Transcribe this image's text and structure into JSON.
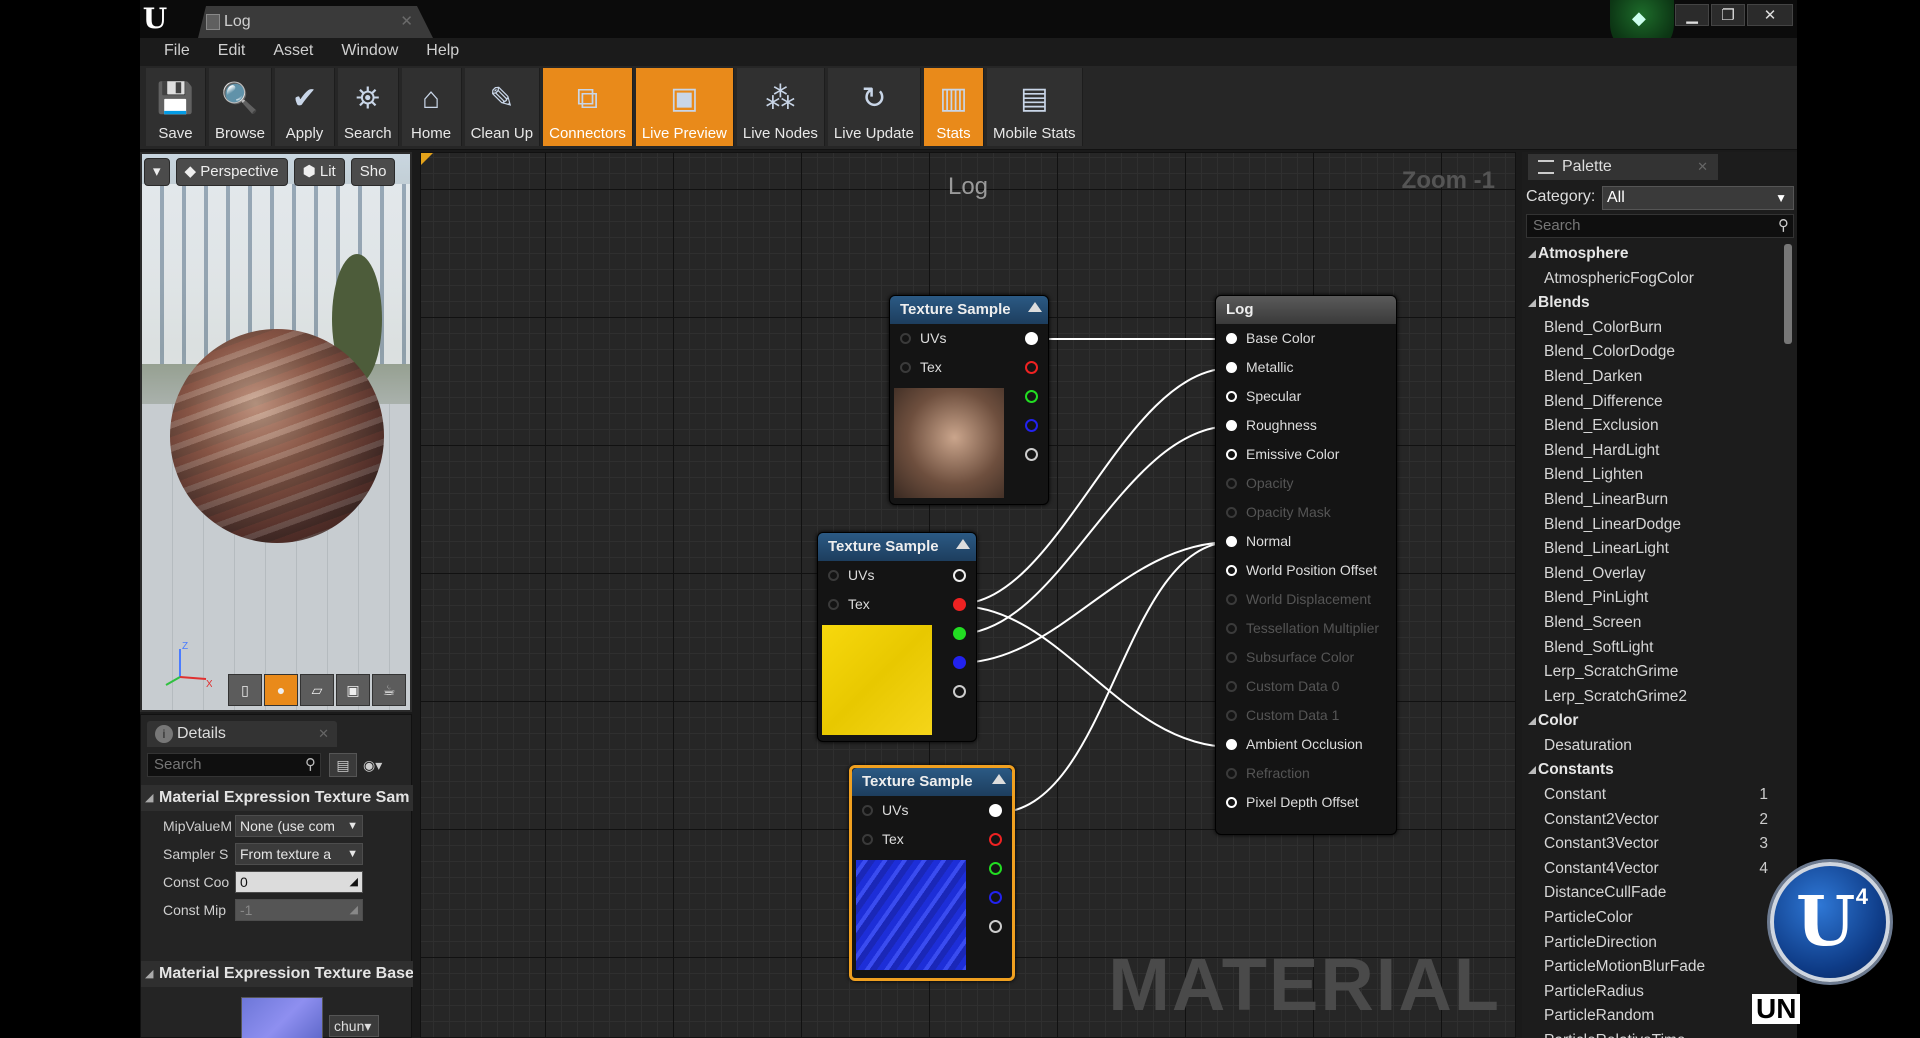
{
  "window": {
    "title": "Log",
    "notify_icon": "notification-icon"
  },
  "menu": [
    "File",
    "Edit",
    "Asset",
    "Window",
    "Help"
  ],
  "toolbar": [
    {
      "label": "Save",
      "icon": "save-icon",
      "active": false
    },
    {
      "label": "Browse",
      "icon": "browse-icon",
      "active": false
    },
    {
      "label": "Apply",
      "icon": "apply-check-icon",
      "active": false
    },
    {
      "label": "Search",
      "icon": "search-binoculars-icon",
      "active": false
    },
    {
      "label": "Home",
      "icon": "home-icon",
      "active": false
    },
    {
      "label": "Clean Up",
      "icon": "clean-up-icon",
      "active": false
    },
    {
      "label": "Connectors",
      "icon": "connectors-icon",
      "active": true
    },
    {
      "label": "Live Preview",
      "icon": "live-preview-icon",
      "active": true
    },
    {
      "label": "Live Nodes",
      "icon": "live-nodes-icon",
      "active": false
    },
    {
      "label": "Live Update",
      "icon": "live-update-icon",
      "active": false
    },
    {
      "label": "Stats",
      "icon": "stats-icon",
      "active": true
    },
    {
      "label": "Mobile Stats",
      "icon": "mobile-stats-icon",
      "active": false
    }
  ],
  "viewport": {
    "perspective": "Perspective",
    "lit": "Lit",
    "show": "Sho"
  },
  "details": {
    "tab": "Details",
    "search_placeholder": "Search",
    "section1": "Material Expression Texture Sam",
    "props": [
      {
        "label": "MipValueM",
        "value": "None (use com",
        "kind": "dropdown"
      },
      {
        "label": "Sampler S",
        "value": "From texture a",
        "kind": "dropdown"
      },
      {
        "label": "Const Coo",
        "value": "0",
        "kind": "text"
      },
      {
        "label": "Const Mip",
        "value": "-1",
        "kind": "disabled"
      }
    ],
    "section2": "Material Expression Texture Base",
    "texture_chip": "chun"
  },
  "graph": {
    "title": "Log",
    "zoom": "Zoom -1",
    "watermark": "MATERIAL",
    "nodes": [
      {
        "title": "Texture Sample",
        "pins": [
          "UVs",
          "Tex"
        ],
        "thumb": "#8b6a52"
      },
      {
        "title": "Texture Sample",
        "pins": [
          "UVs",
          "Tex"
        ],
        "thumb": "#f5d20a"
      },
      {
        "title": "Texture Sample",
        "pins": [
          "UVs",
          "Tex"
        ],
        "thumb": "#1e2fd8"
      }
    ],
    "result": {
      "title": "Log",
      "inputs": [
        {
          "label": "Base Color",
          "enabled": true,
          "connected": true
        },
        {
          "label": "Metallic",
          "enabled": true,
          "connected": true
        },
        {
          "label": "Specular",
          "enabled": true,
          "connected": false
        },
        {
          "label": "Roughness",
          "enabled": true,
          "connected": true
        },
        {
          "label": "Emissive Color",
          "enabled": true,
          "connected": false
        },
        {
          "label": "Opacity",
          "enabled": false,
          "connected": false
        },
        {
          "label": "Opacity Mask",
          "enabled": false,
          "connected": false
        },
        {
          "label": "Normal",
          "enabled": true,
          "connected": true
        },
        {
          "label": "World Position Offset",
          "enabled": true,
          "connected": false
        },
        {
          "label": "World Displacement",
          "enabled": false,
          "connected": false
        },
        {
          "label": "Tessellation Multiplier",
          "enabled": false,
          "connected": false
        },
        {
          "label": "Subsurface Color",
          "enabled": false,
          "connected": false
        },
        {
          "label": "Custom Data 0",
          "enabled": false,
          "connected": false
        },
        {
          "label": "Custom Data 1",
          "enabled": false,
          "connected": false
        },
        {
          "label": "Ambient Occlusion",
          "enabled": true,
          "connected": true
        },
        {
          "label": "Refraction",
          "enabled": false,
          "connected": false
        },
        {
          "label": "Pixel Depth Offset",
          "enabled": true,
          "connected": false
        }
      ]
    }
  },
  "palette": {
    "tab": "Palette",
    "category_label": "Category:",
    "category_value": "All",
    "search_placeholder": "Search",
    "list": [
      {
        "type": "cat",
        "label": "Atmosphere"
      },
      {
        "type": "item",
        "label": "AtmosphericFogColor"
      },
      {
        "type": "cat",
        "label": "Blends"
      },
      {
        "type": "item",
        "label": "Blend_ColorBurn"
      },
      {
        "type": "item",
        "label": "Blend_ColorDodge"
      },
      {
        "type": "item",
        "label": "Blend_Darken"
      },
      {
        "type": "item",
        "label": "Blend_Difference"
      },
      {
        "type": "item",
        "label": "Blend_Exclusion"
      },
      {
        "type": "item",
        "label": "Blend_HardLight"
      },
      {
        "type": "item",
        "label": "Blend_Lighten"
      },
      {
        "type": "item",
        "label": "Blend_LinearBurn"
      },
      {
        "type": "item",
        "label": "Blend_LinearDodge"
      },
      {
        "type": "item",
        "label": "Blend_LinearLight"
      },
      {
        "type": "item",
        "label": "Blend_Overlay"
      },
      {
        "type": "item",
        "label": "Blend_PinLight"
      },
      {
        "type": "item",
        "label": "Blend_Screen"
      },
      {
        "type": "item",
        "label": "Blend_SoftLight"
      },
      {
        "type": "item",
        "label": "Lerp_ScratchGrime"
      },
      {
        "type": "item",
        "label": "Lerp_ScratchGrime2"
      },
      {
        "type": "cat",
        "label": "Color"
      },
      {
        "type": "item",
        "label": "Desaturation"
      },
      {
        "type": "cat",
        "label": "Constants"
      },
      {
        "type": "item",
        "label": "Constant",
        "hotkey": "1"
      },
      {
        "type": "item",
        "label": "Constant2Vector",
        "hotkey": "2"
      },
      {
        "type": "item",
        "label": "Constant3Vector",
        "hotkey": "3"
      },
      {
        "type": "item",
        "label": "Constant4Vector",
        "hotkey": "4"
      },
      {
        "type": "item",
        "label": "DistanceCullFade"
      },
      {
        "type": "item",
        "label": "ParticleColor"
      },
      {
        "type": "item",
        "label": "ParticleDirection"
      },
      {
        "type": "item",
        "label": "ParticleMotionBlurFade"
      },
      {
        "type": "item",
        "label": "ParticleRadius"
      },
      {
        "type": "item",
        "label": "ParticleRandom"
      },
      {
        "type": "item",
        "label": "ParticleRelativeTime"
      }
    ]
  },
  "badge": {
    "version": "4",
    "corner_text": "UN"
  }
}
